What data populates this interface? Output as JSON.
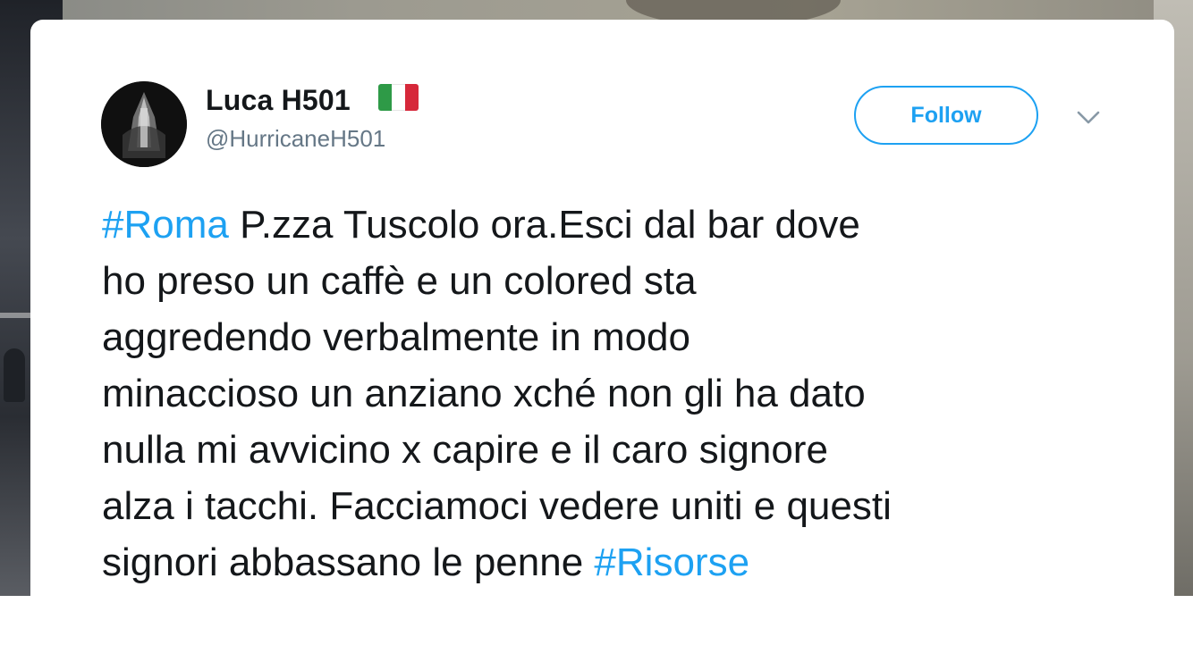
{
  "user": {
    "display_name": "Luca H501",
    "flag_emoji": "🇮🇹",
    "flag_colors": [
      "#2e9a47",
      "#ffffff",
      "#d6283a"
    ],
    "handle": "@HurricaneH501",
    "avatar_icon": "avatar-image"
  },
  "actions": {
    "follow_label": "Follow",
    "menu_icon": "chevron-down-icon"
  },
  "tweet": {
    "lines": [
      [
        {
          "text": "#Roma",
          "hashtag": true
        },
        {
          "text": " P.zza Tuscolo ora.Esci dal bar dove",
          "hashtag": false
        }
      ],
      [
        {
          "text": "ho preso un caffè e un colored sta",
          "hashtag": false
        }
      ],
      [
        {
          "text": "aggredendo verbalmente in modo",
          "hashtag": false
        }
      ],
      [
        {
          "text": "minaccioso un anziano xché non gli ha dato",
          "hashtag": false
        }
      ],
      [
        {
          "text": "nulla mi avvicino x capire e il caro signore",
          "hashtag": false
        }
      ],
      [
        {
          "text": "alza i tacchi. Facciamoci vedere uniti e questi",
          "hashtag": false
        }
      ],
      [
        {
          "text": "signori abbassano le penne ",
          "hashtag": false
        },
        {
          "text": "#Risorse",
          "hashtag": true
        }
      ]
    ]
  },
  "colors": {
    "accent": "#1da1f2",
    "text": "#14171a",
    "muted": "#657786"
  }
}
